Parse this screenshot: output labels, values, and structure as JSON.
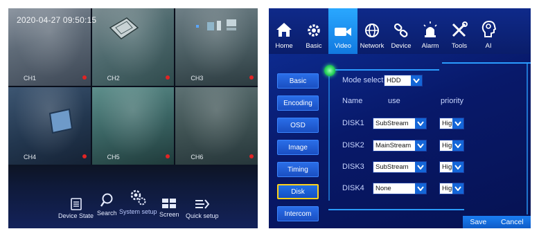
{
  "left_panel": {
    "timestamp": "2020-04-27 09:50:15",
    "channels": [
      "CH1",
      "CH2",
      "CH3",
      "CH4",
      "CH5",
      "CH6"
    ],
    "toolbar": [
      {
        "label": "Device State",
        "icon": "device-state-icon"
      },
      {
        "label": "Search",
        "icon": "search-icon"
      },
      {
        "label": "System setup",
        "icon": "gears-icon"
      },
      {
        "label": "Screen",
        "icon": "screen-split-icon"
      },
      {
        "label": "Quick setup",
        "icon": "quick-setup-icon"
      }
    ]
  },
  "right_panel": {
    "tabs": [
      {
        "label": "Home",
        "icon": "home-icon"
      },
      {
        "label": "Basic",
        "icon": "gear-icon"
      },
      {
        "label": "Video",
        "icon": "video-camera-icon"
      },
      {
        "label": "Network",
        "icon": "globe-icon"
      },
      {
        "label": "Device",
        "icon": "link-icon"
      },
      {
        "label": "Alarm",
        "icon": "alarm-light-icon"
      },
      {
        "label": "Tools",
        "icon": "tools-icon"
      },
      {
        "label": "AI",
        "icon": "ai-head-icon"
      }
    ],
    "active_tab": "Video",
    "side_menu": [
      "Basic",
      "Encoding",
      "OSD",
      "Image",
      "Timing",
      "Disk",
      "Intercom"
    ],
    "active_side": "Disk",
    "mode_label": "Mode selecti",
    "mode_value": "HDD",
    "headers": {
      "name": "Name",
      "use": "use",
      "priority": "priority"
    },
    "disks": [
      {
        "name": "DISK1",
        "use": "SubStream",
        "priority": "High"
      },
      {
        "name": "DISK2",
        "use": "MainStream",
        "priority": "High"
      },
      {
        "name": "DISK3",
        "use": "SubStream",
        "priority": "High"
      },
      {
        "name": "DISK4",
        "use": "None",
        "priority": "High"
      }
    ],
    "save_label": "Save",
    "cancel_label": "Cancel",
    "colors": {
      "accent": "#1a7ef2",
      "active_border": "#ffd21a",
      "panel_bg": "#061040"
    }
  }
}
